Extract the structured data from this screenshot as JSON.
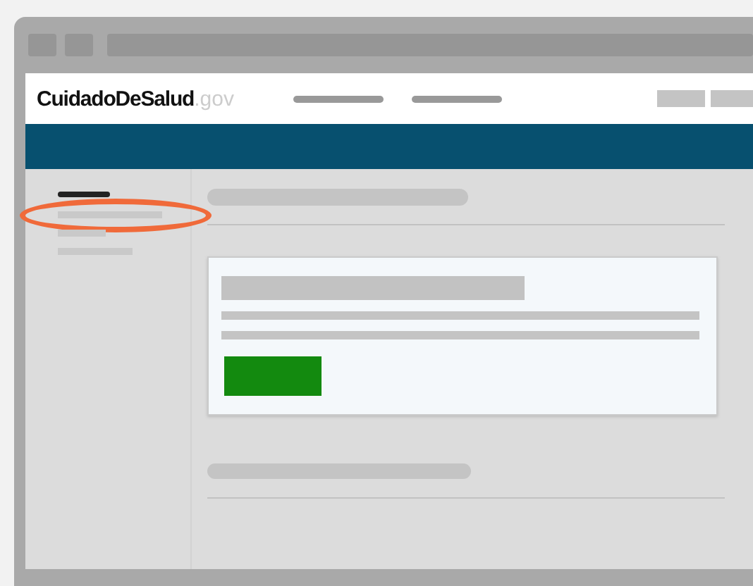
{
  "logo": {
    "name": "CuidadoDeSalud",
    "suffix": ".gov"
  },
  "sidebar": {
    "items": [
      {
        "highlighted": true
      },
      {
        "highlighted": false
      },
      {
        "highlighted": false
      }
    ]
  }
}
